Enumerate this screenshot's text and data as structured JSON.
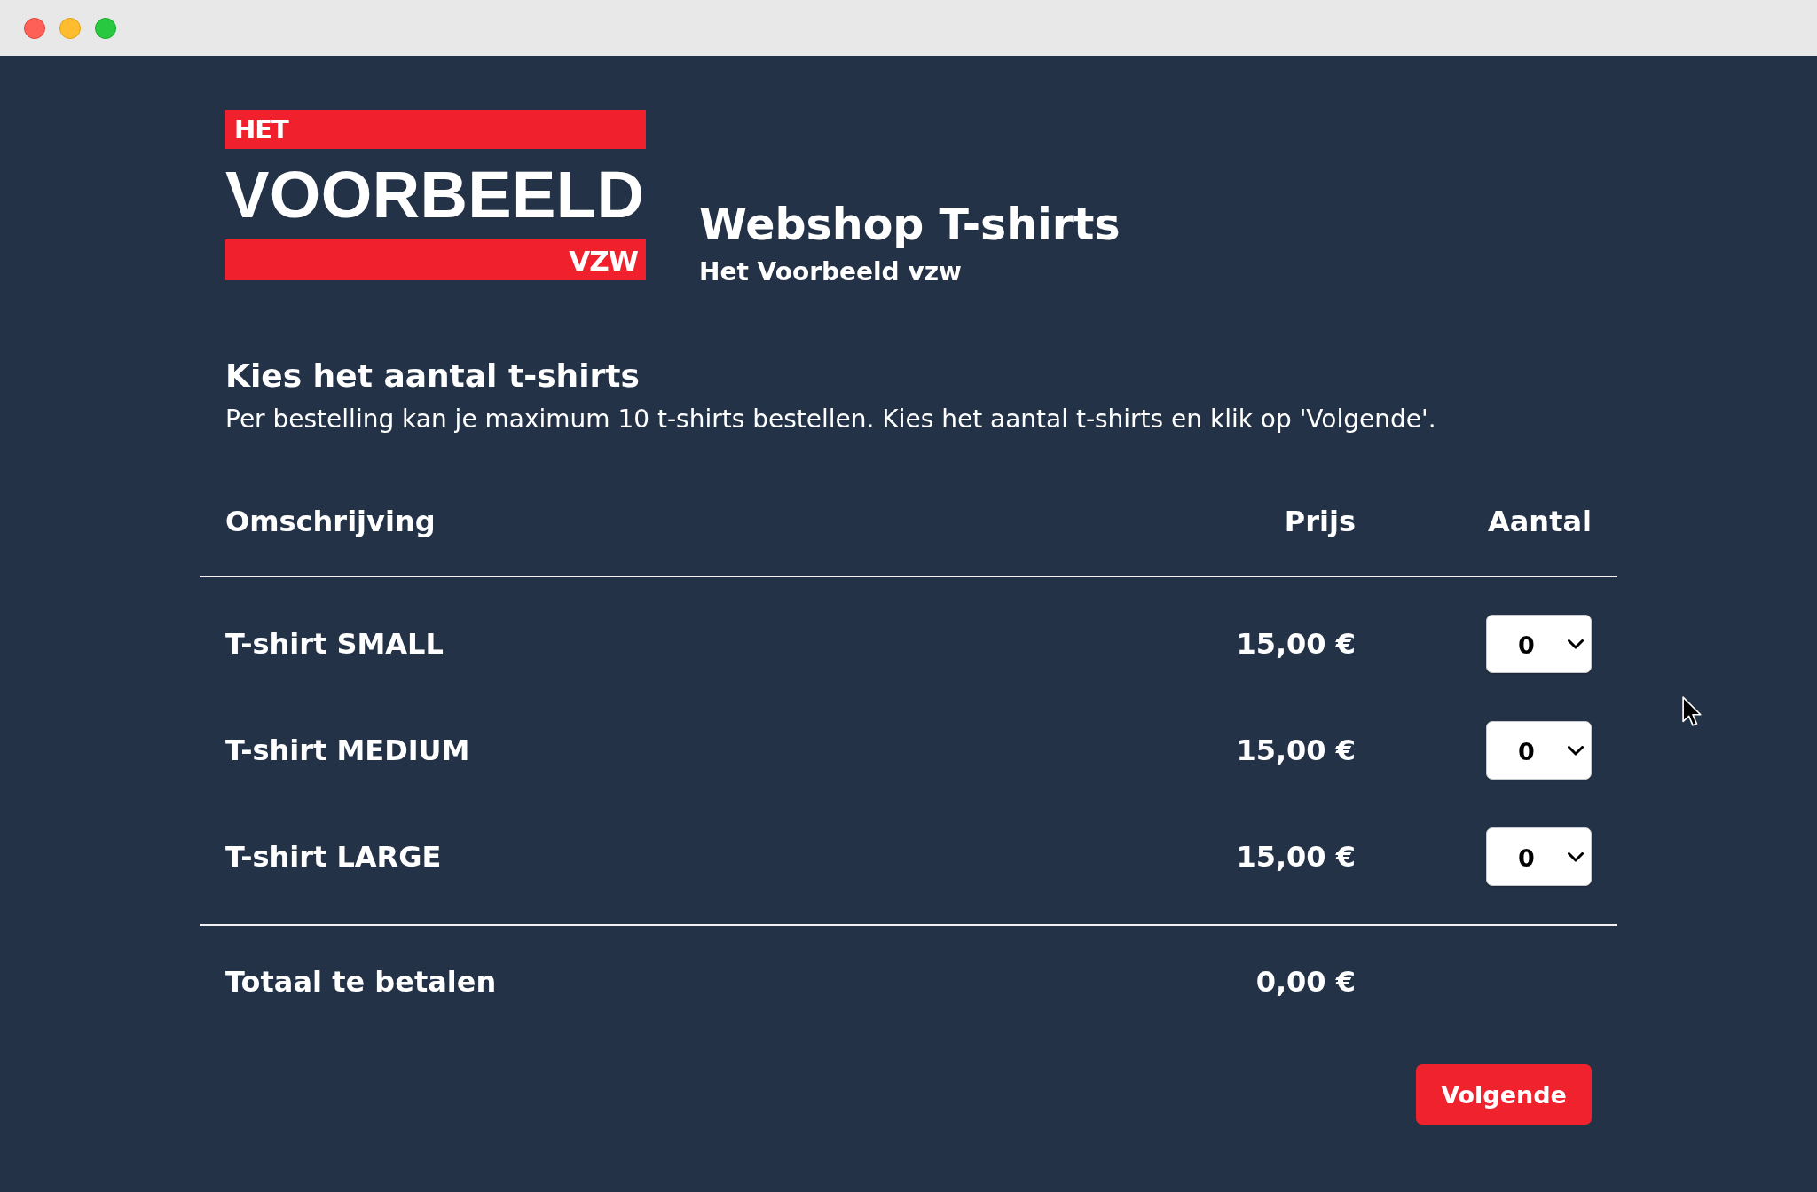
{
  "logo": {
    "top": "HET",
    "wordmark": "VOORBEELD",
    "bottom": "VZW"
  },
  "header": {
    "title": "Webshop T-shirts",
    "subtitle": "Het Voorbeeld vzw"
  },
  "intro": {
    "heading": "Kies het aantal t-shirts",
    "text": "Per bestelling kan je maximum 10 t-shirts bestellen. Kies het aantal t-shirts en klik op 'Volgende'."
  },
  "table": {
    "columns": [
      "Omschrijving",
      "Prijs",
      "Aantal"
    ],
    "rows": [
      {
        "description": "T-shirt SMALL",
        "price": "15,00 €",
        "quantity": "0"
      },
      {
        "description": "T-shirt MEDIUM",
        "price": "15,00 €",
        "quantity": "0"
      },
      {
        "description": "T-shirt LARGE",
        "price": "15,00 €",
        "quantity": "0"
      }
    ]
  },
  "total": {
    "label": "Totaal te betalen",
    "amount": "0,00 €"
  },
  "buttons": [
    "Volgende"
  ]
}
